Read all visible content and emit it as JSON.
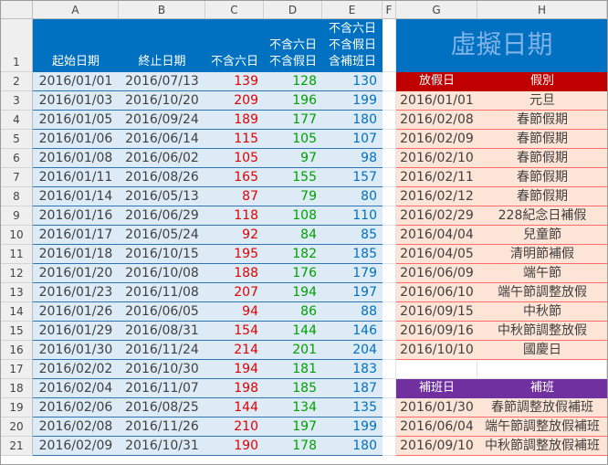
{
  "columns": [
    "A",
    "B",
    "C",
    "D",
    "E",
    "F",
    "G",
    "H"
  ],
  "rows": [
    "1",
    "2",
    "3",
    "4",
    "5",
    "6",
    "7",
    "8",
    "9",
    "10",
    "11",
    "12",
    "13",
    "14",
    "15",
    "16",
    "17",
    "18",
    "19",
    "20",
    "21"
  ],
  "headers": {
    "start": "起始日期",
    "end": "終止日期",
    "c": [
      "不含六日"
    ],
    "d": [
      "不含六日",
      "不含假日"
    ],
    "e": [
      "不含六日",
      "不含假日",
      "含補班日"
    ]
  },
  "title": "虛擬日期",
  "holiday_header": {
    "date": "放假日",
    "name": "假別"
  },
  "makeup_header": {
    "date": "補班日",
    "name": "補班"
  },
  "data_rows": [
    {
      "start": "2016/01/01",
      "end": "2016/07/13",
      "c": "139",
      "d": "128",
      "e": "130"
    },
    {
      "start": "2016/01/03",
      "end": "2016/10/20",
      "c": "209",
      "d": "196",
      "e": "199"
    },
    {
      "start": "2016/01/05",
      "end": "2016/09/24",
      "c": "189",
      "d": "177",
      "e": "180"
    },
    {
      "start": "2016/01/06",
      "end": "2016/06/14",
      "c": "115",
      "d": "105",
      "e": "107"
    },
    {
      "start": "2016/01/08",
      "end": "2016/06/02",
      "c": "105",
      "d": "97",
      "e": "98"
    },
    {
      "start": "2016/01/11",
      "end": "2016/08/26",
      "c": "165",
      "d": "155",
      "e": "157"
    },
    {
      "start": "2016/01/14",
      "end": "2016/05/13",
      "c": "87",
      "d": "79",
      "e": "80"
    },
    {
      "start": "2016/01/16",
      "end": "2016/06/29",
      "c": "118",
      "d": "108",
      "e": "110"
    },
    {
      "start": "2016/01/17",
      "end": "2016/05/24",
      "c": "92",
      "d": "84",
      "e": "85"
    },
    {
      "start": "2016/01/18",
      "end": "2016/10/15",
      "c": "195",
      "d": "182",
      "e": "185"
    },
    {
      "start": "2016/01/20",
      "end": "2016/10/08",
      "c": "188",
      "d": "176",
      "e": "179"
    },
    {
      "start": "2016/01/23",
      "end": "2016/11/08",
      "c": "207",
      "d": "194",
      "e": "197"
    },
    {
      "start": "2016/01/26",
      "end": "2016/06/05",
      "c": "94",
      "d": "86",
      "e": "88"
    },
    {
      "start": "2016/01/29",
      "end": "2016/08/31",
      "c": "154",
      "d": "144",
      "e": "146"
    },
    {
      "start": "2016/01/30",
      "end": "2016/11/24",
      "c": "214",
      "d": "201",
      "e": "204"
    },
    {
      "start": "2016/02/02",
      "end": "2016/10/30",
      "c": "194",
      "d": "181",
      "e": "183"
    },
    {
      "start": "2016/02/04",
      "end": "2016/11/07",
      "c": "198",
      "d": "185",
      "e": "187"
    },
    {
      "start": "2016/02/06",
      "end": "2016/08/25",
      "c": "144",
      "d": "134",
      "e": "135"
    },
    {
      "start": "2016/02/08",
      "end": "2016/11/26",
      "c": "210",
      "d": "197",
      "e": "199"
    },
    {
      "start": "2016/02/09",
      "end": "2016/10/31",
      "c": "190",
      "d": "178",
      "e": "180"
    }
  ],
  "holidays": [
    {
      "date": "2016/01/01",
      "name": "元旦"
    },
    {
      "date": "2016/02/08",
      "name": "春節假期"
    },
    {
      "date": "2016/02/09",
      "name": "春節假期"
    },
    {
      "date": "2016/02/10",
      "name": "春節假期"
    },
    {
      "date": "2016/02/11",
      "name": "春節假期"
    },
    {
      "date": "2016/02/12",
      "name": "春節假期"
    },
    {
      "date": "2016/02/29",
      "name": "228紀念日補假"
    },
    {
      "date": "2016/04/04",
      "name": "兒童節"
    },
    {
      "date": "2016/04/05",
      "name": "清明節補假"
    },
    {
      "date": "2016/06/09",
      "name": "端午節"
    },
    {
      "date": "2016/06/10",
      "name": "端午節調整放假"
    },
    {
      "date": "2016/09/15",
      "name": "中秋節"
    },
    {
      "date": "2016/09/16",
      "name": "中秋節調整放假"
    },
    {
      "date": "2016/10/10",
      "name": "國慶日"
    }
  ],
  "makeup_days": [
    {
      "date": "2016/01/30",
      "name": "春節調整放假補班"
    },
    {
      "date": "2016/06/04",
      "name": "端午節調整放假補班"
    },
    {
      "date": "2016/09/10",
      "name": "中秋節調整放假補班"
    }
  ],
  "colors": {
    "header_blue": "#0070c0",
    "body_blue": "#ddebf7",
    "holiday_header": "#c00000",
    "makeup_header": "#7030a0",
    "holiday_body": "#fce4d6",
    "c_value": "#e00000",
    "d_value": "#00a000",
    "e_value": "#0070c0"
  }
}
